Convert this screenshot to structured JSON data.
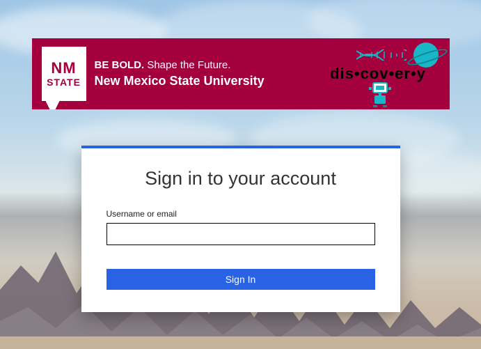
{
  "banner": {
    "badge_line1": "NM",
    "badge_line2": "STATE",
    "tagline_bold": "BE BOLD.",
    "tagline_rest": " Shape the Future.",
    "university": "New Mexico State University",
    "discovery_word": "dis•cov•er•y"
  },
  "login": {
    "heading": "Sign in to your account",
    "username_label": "Username or email",
    "username_value": "",
    "submit_label": "Sign In"
  },
  "colors": {
    "brand_crimson": "#a3003d",
    "accent_blue": "#2a62e6",
    "discovery_teal": "#19b6c7"
  }
}
